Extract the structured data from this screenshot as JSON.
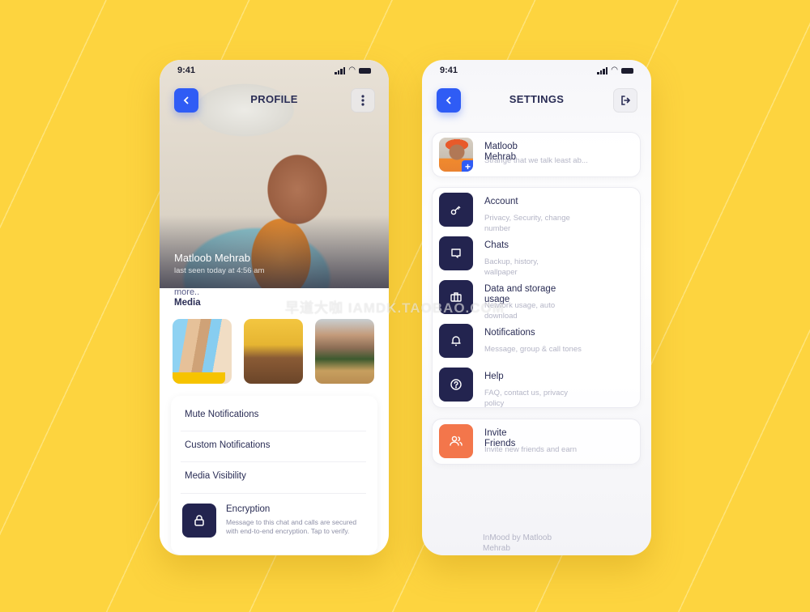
{
  "status_bar": {
    "time": "9:41"
  },
  "profile": {
    "header_title": "PROFILE",
    "name": "Matloob Mehrab",
    "last_seen": "last seen today at 4:56 am",
    "more_link": "more..",
    "media_label": "Media",
    "options": [
      "Mute Notifications",
      "Custom Notifications",
      "Media Visibility"
    ],
    "encryption": {
      "title": "Encryption",
      "description": "Message to this chat and calls are secured with end-to-end encryption. Tap to verify."
    }
  },
  "settings": {
    "header_title": "SETTINGS",
    "user": {
      "name": "Matloob Mehrab",
      "status": "Strange that we talk least ab..."
    },
    "items": [
      {
        "title": "Account",
        "subtitle": "Privacy, Security, change number",
        "icon": "key-icon"
      },
      {
        "title": "Chats",
        "subtitle": "Backup, history, wallpaper",
        "icon": "chat-icon"
      },
      {
        "title": "Data and storage usage",
        "subtitle": "Network usage, auto download",
        "icon": "briefcase-icon"
      },
      {
        "title": "Notifications",
        "subtitle": "Message, group & call tones",
        "icon": "bell-icon"
      },
      {
        "title": "Help",
        "subtitle": "FAQ, contact us, privacy policy",
        "icon": "help-icon"
      }
    ],
    "invite": {
      "title": "Invite Friends",
      "subtitle": "Invite new friends and earn",
      "icon": "users-icon"
    },
    "footer": "InMood by Matloob Mehrab"
  },
  "colors": {
    "background": "#fdd43f",
    "accent": "#2f5cf5",
    "dark": "#23244f",
    "orange": "#f3764b"
  },
  "watermark": "早道大咖  IAMDK.TAOBAO.COM"
}
